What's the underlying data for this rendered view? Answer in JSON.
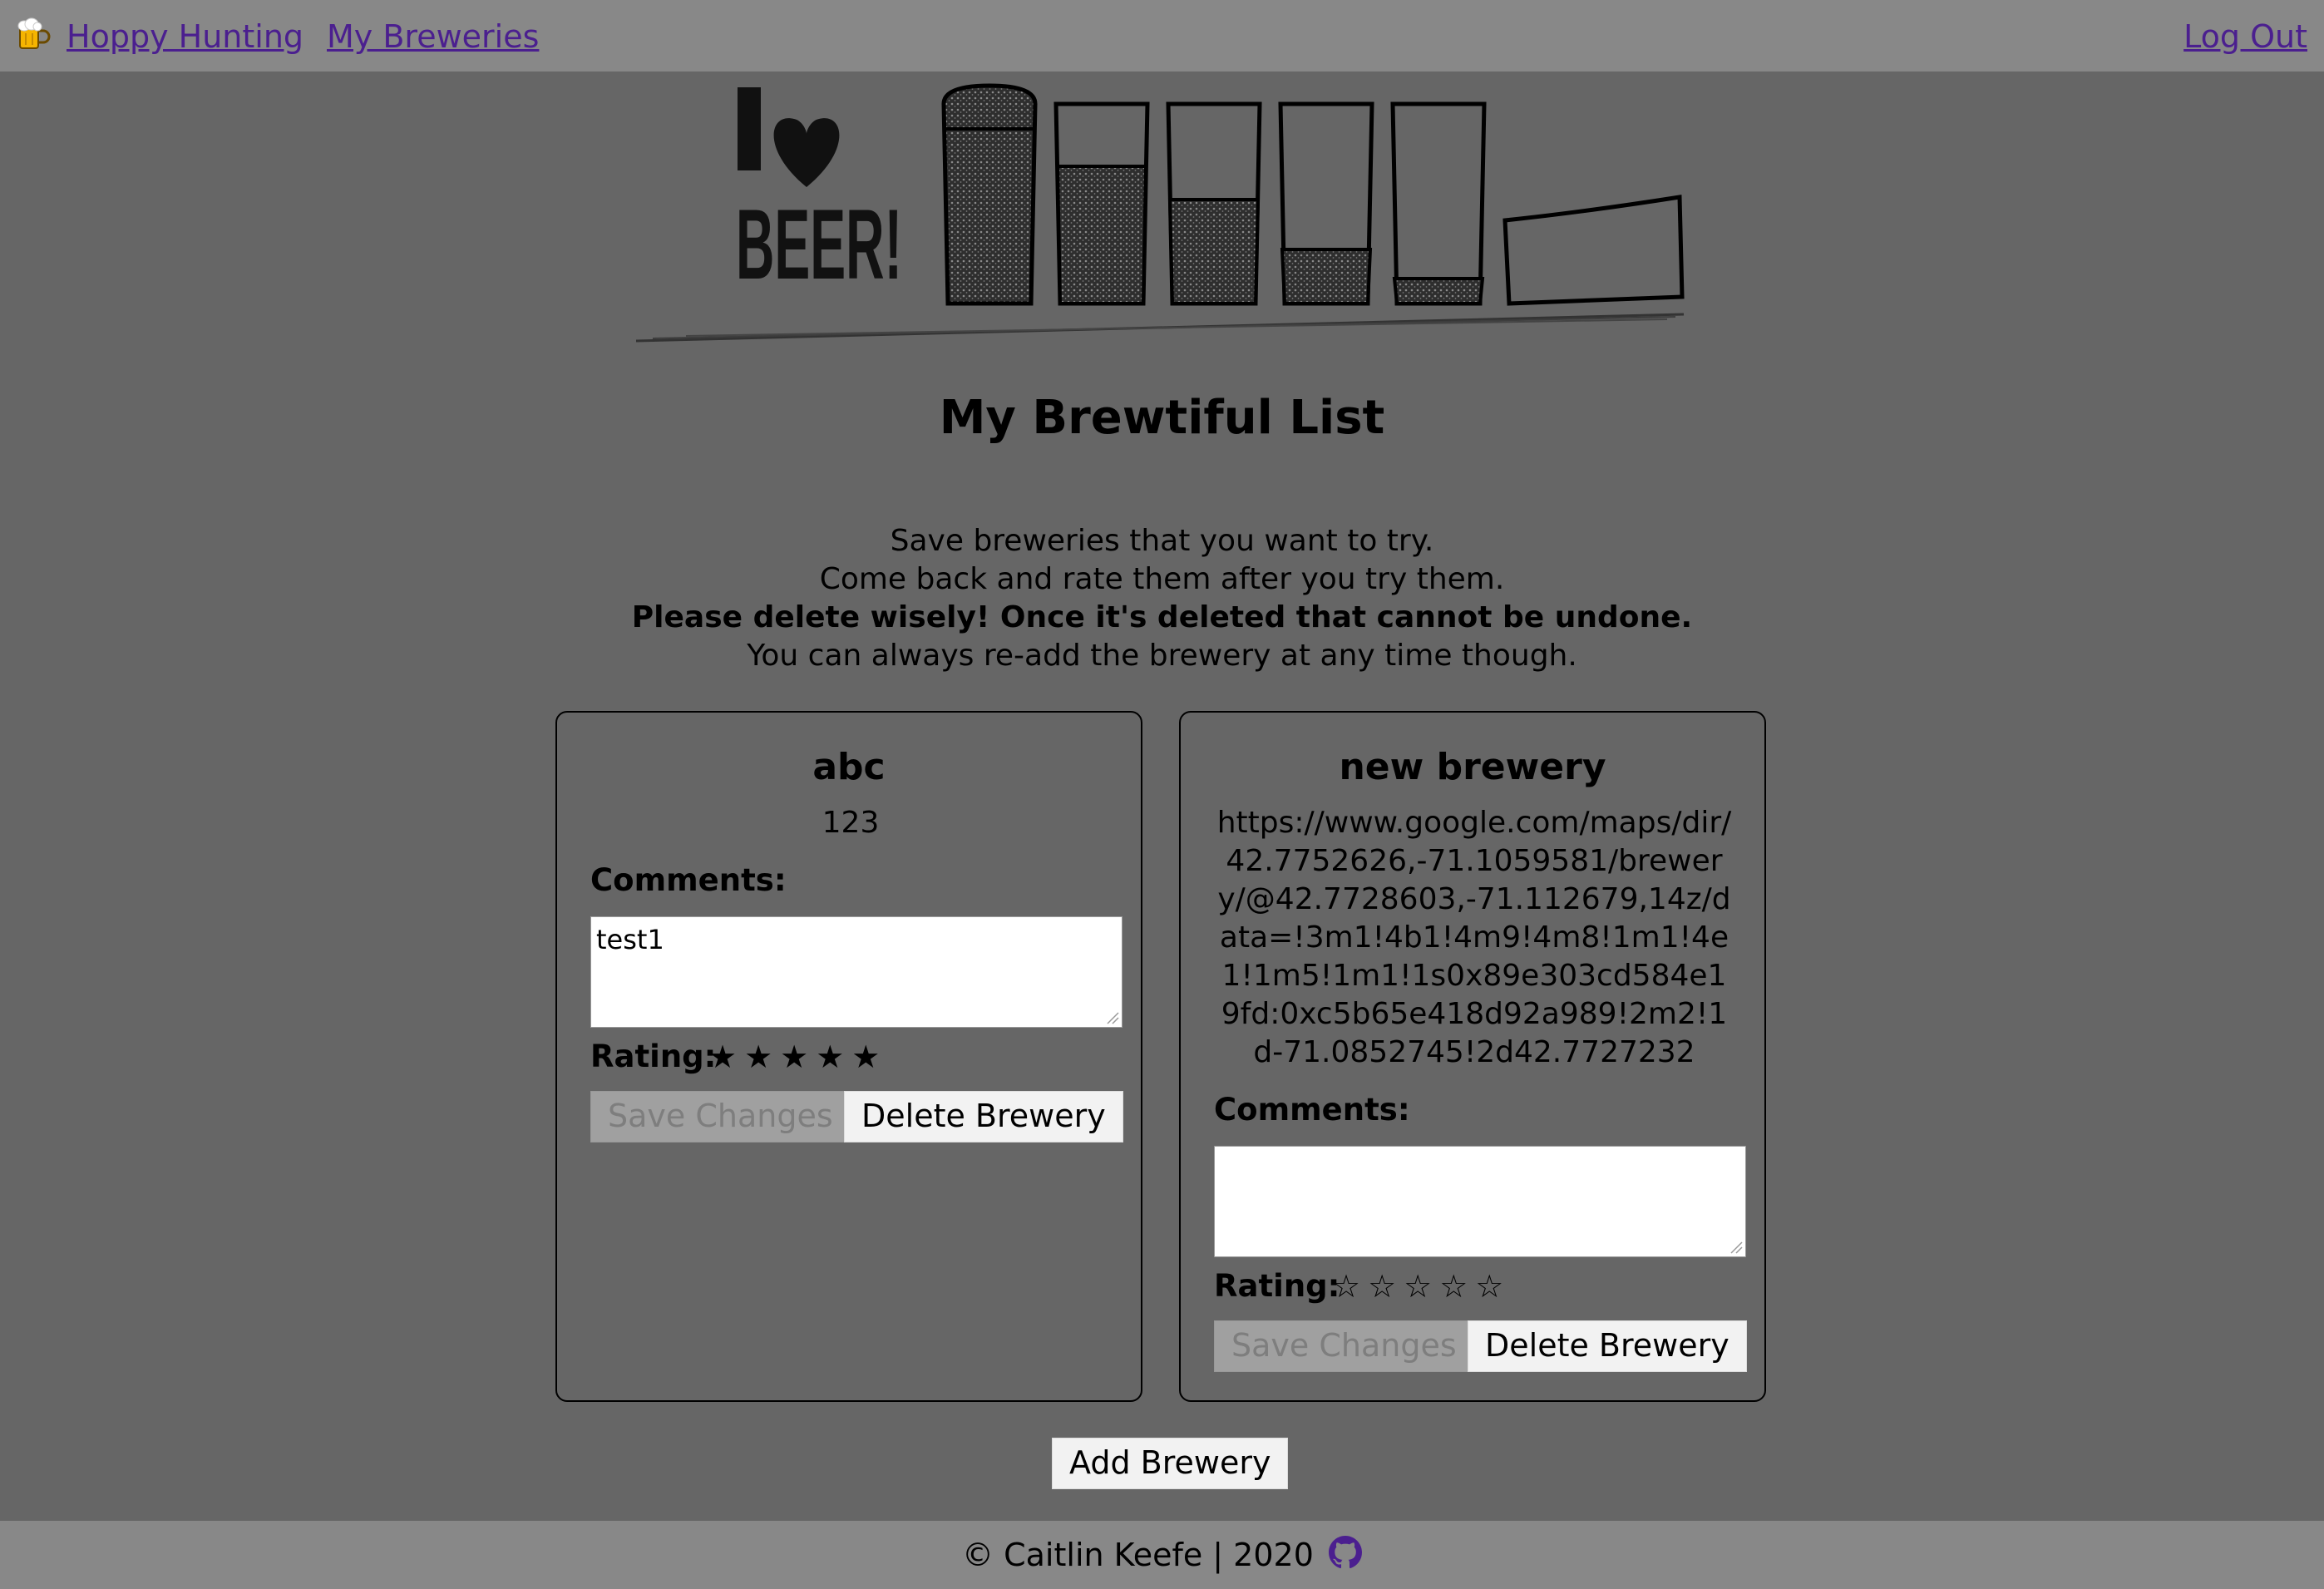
{
  "nav": {
    "logo_icon": "beer-mug-icon",
    "home_label": "Hoppy Hunting",
    "breweries_label": "My Breweries",
    "logout_label": "Log Out",
    "link_color": "#4b1f8f"
  },
  "hero": {
    "alt": "I love BEER!"
  },
  "page": {
    "title": "My Brewtiful List",
    "intro_line1": "Save breweries that you want to try.",
    "intro_line2": "Come back and rate them after you try them.",
    "intro_warning": "Please delete wisely! Once it's deleted that cannot be undone.",
    "intro_line4": "You can always re-add the brewery at any time though."
  },
  "cards": [
    {
      "name": "abc",
      "info": "123",
      "comments_label": "Comments:",
      "comments_value": "test1",
      "rating_label": "Rating:",
      "rating": 5,
      "rating_max": 5,
      "stars_text": "★★★★★",
      "save_label": "Save Changes",
      "delete_label": "Delete Brewery"
    },
    {
      "name": "new brewery",
      "info": "https://www.google.com/maps/dir/42.7752626,-71.1059581/brewery/@42.7728603,-71.112679,14z/data=!3m1!4b1!4m9!4m8!1m1!4e1!1m5!1m1!1s0x89e303cd584e19fd:0xc5b65e418d92a989!2m2!1d-71.0852745!2d42.7727232",
      "comments_label": "Comments:",
      "comments_value": "",
      "rating_label": "Rating:",
      "rating": 0,
      "rating_max": 5,
      "stars_text": "☆☆☆☆☆",
      "save_label": "Save Changes",
      "delete_label": "Delete Brewery"
    }
  ],
  "actions": {
    "add_label": "Add Brewery"
  },
  "footer": {
    "text": "© Caitlin Keefe | 2020",
    "icon": "github-icon",
    "icon_color": "#4b1f8f"
  },
  "colors": {
    "background": "#666666",
    "bars": "#888888"
  }
}
